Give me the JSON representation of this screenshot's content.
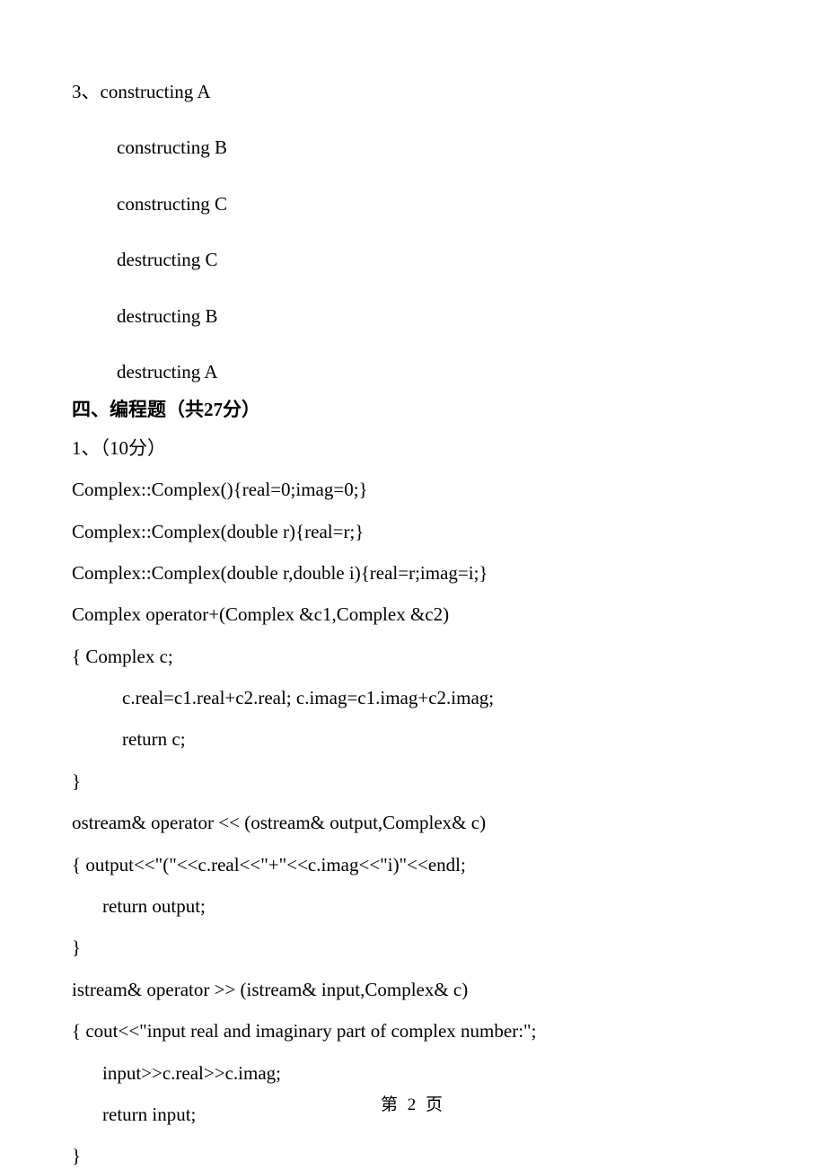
{
  "q3": {
    "number": "3、",
    "lines": [
      "constructing A",
      "constructing B",
      "constructing C",
      "destructing C",
      "destructing B",
      "destructing A"
    ]
  },
  "section4": {
    "heading": "四、编程题（共27分）",
    "q1": {
      "number": "1、（10分）",
      "lines": [
        "Complex::Complex(){real=0;imag=0;}",
        "Complex::Complex(double r){real=r;}",
        "Complex::Complex(double r,double i){real=r;imag=i;}",
        "Complex operator+(Complex &c1,Complex &c2)",
        "{      Complex c;",
        "c.real=c1.real+c2.real; c.imag=c1.imag+c2.imag;",
        "return c;",
        "}",
        "ostream& operator << (ostream& output,Complex& c)",
        "{    output<<\"(\"<<c.real<<\"+\"<<c.imag<<\"i)\"<<endl;",
        "return output;",
        "}",
        "istream& operator >> (istream& input,Complex& c)",
        "{    cout<<\"input real and imaginary part of complex number:\";",
        "input>>c.real>>c.imag;",
        "return input;",
        "}"
      ]
    }
  },
  "pageNum": "第 2 页"
}
